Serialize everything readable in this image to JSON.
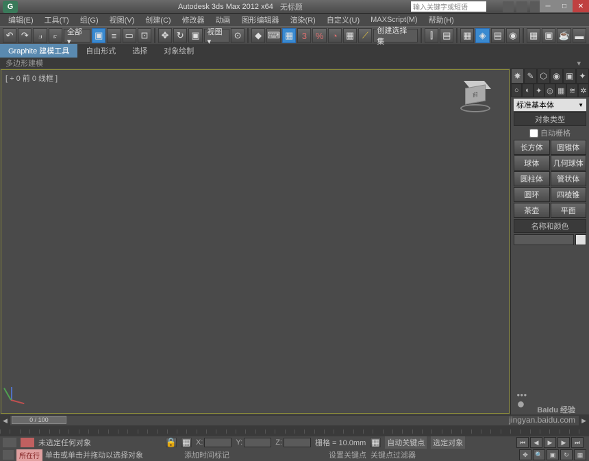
{
  "title": {
    "app": "Autodesk 3ds Max 2012 x64",
    "doc": "无标题",
    "help_placeholder": "输入关键字或短语"
  },
  "win_controls": {
    "min": "─",
    "max": "□",
    "close": "✕"
  },
  "menu": [
    "编辑(E)",
    "工具(T)",
    "组(G)",
    "视图(V)",
    "创建(C)",
    "修改器",
    "动画",
    "图形编辑器",
    "渲染(R)",
    "自定义(U)",
    "MAXScript(M)",
    "帮助(H)"
  ],
  "toolbar": {
    "dd_all": "全部 ▾",
    "dd_view": "视图 ▾",
    "dd_set": "创建选择集"
  },
  "ribbon": {
    "tabs": [
      "Graphite 建模工具",
      "自由形式",
      "选择",
      "对象绘制"
    ],
    "sub": "多边形建模",
    "arrow": "▾"
  },
  "viewport": {
    "label": "[ + 0 前 0 线框 ]"
  },
  "cmd": {
    "category": "标准基本体",
    "rollout_type": "对象类型",
    "auto_grid": "自动栅格",
    "objects": [
      "长方体",
      "圆锥体",
      "球体",
      "几何球体",
      "圆柱体",
      "管状体",
      "圆环",
      "四棱锥",
      "茶壶",
      "平面"
    ],
    "rollout_name": "名称和颜色"
  },
  "timeline": {
    "pos": "0 / 100"
  },
  "status": {
    "msg1": "未选定任何对象",
    "msg2": "单击或单击并拖动以选择对象",
    "x": "X:",
    "y": "Y:",
    "z": "Z:",
    "grid": "栅格 = 10.0mm",
    "add_time": "添加时间标记",
    "auto_key": "自动关键点",
    "sel_obj": "选定对象",
    "set_key": "设置关键点",
    "key_filter": "关键点过滤器"
  },
  "prompt": {
    "btn": "所在行"
  },
  "watermark": {
    "main": "Baidu 经验",
    "sub": "jingyan.baidu.com"
  }
}
